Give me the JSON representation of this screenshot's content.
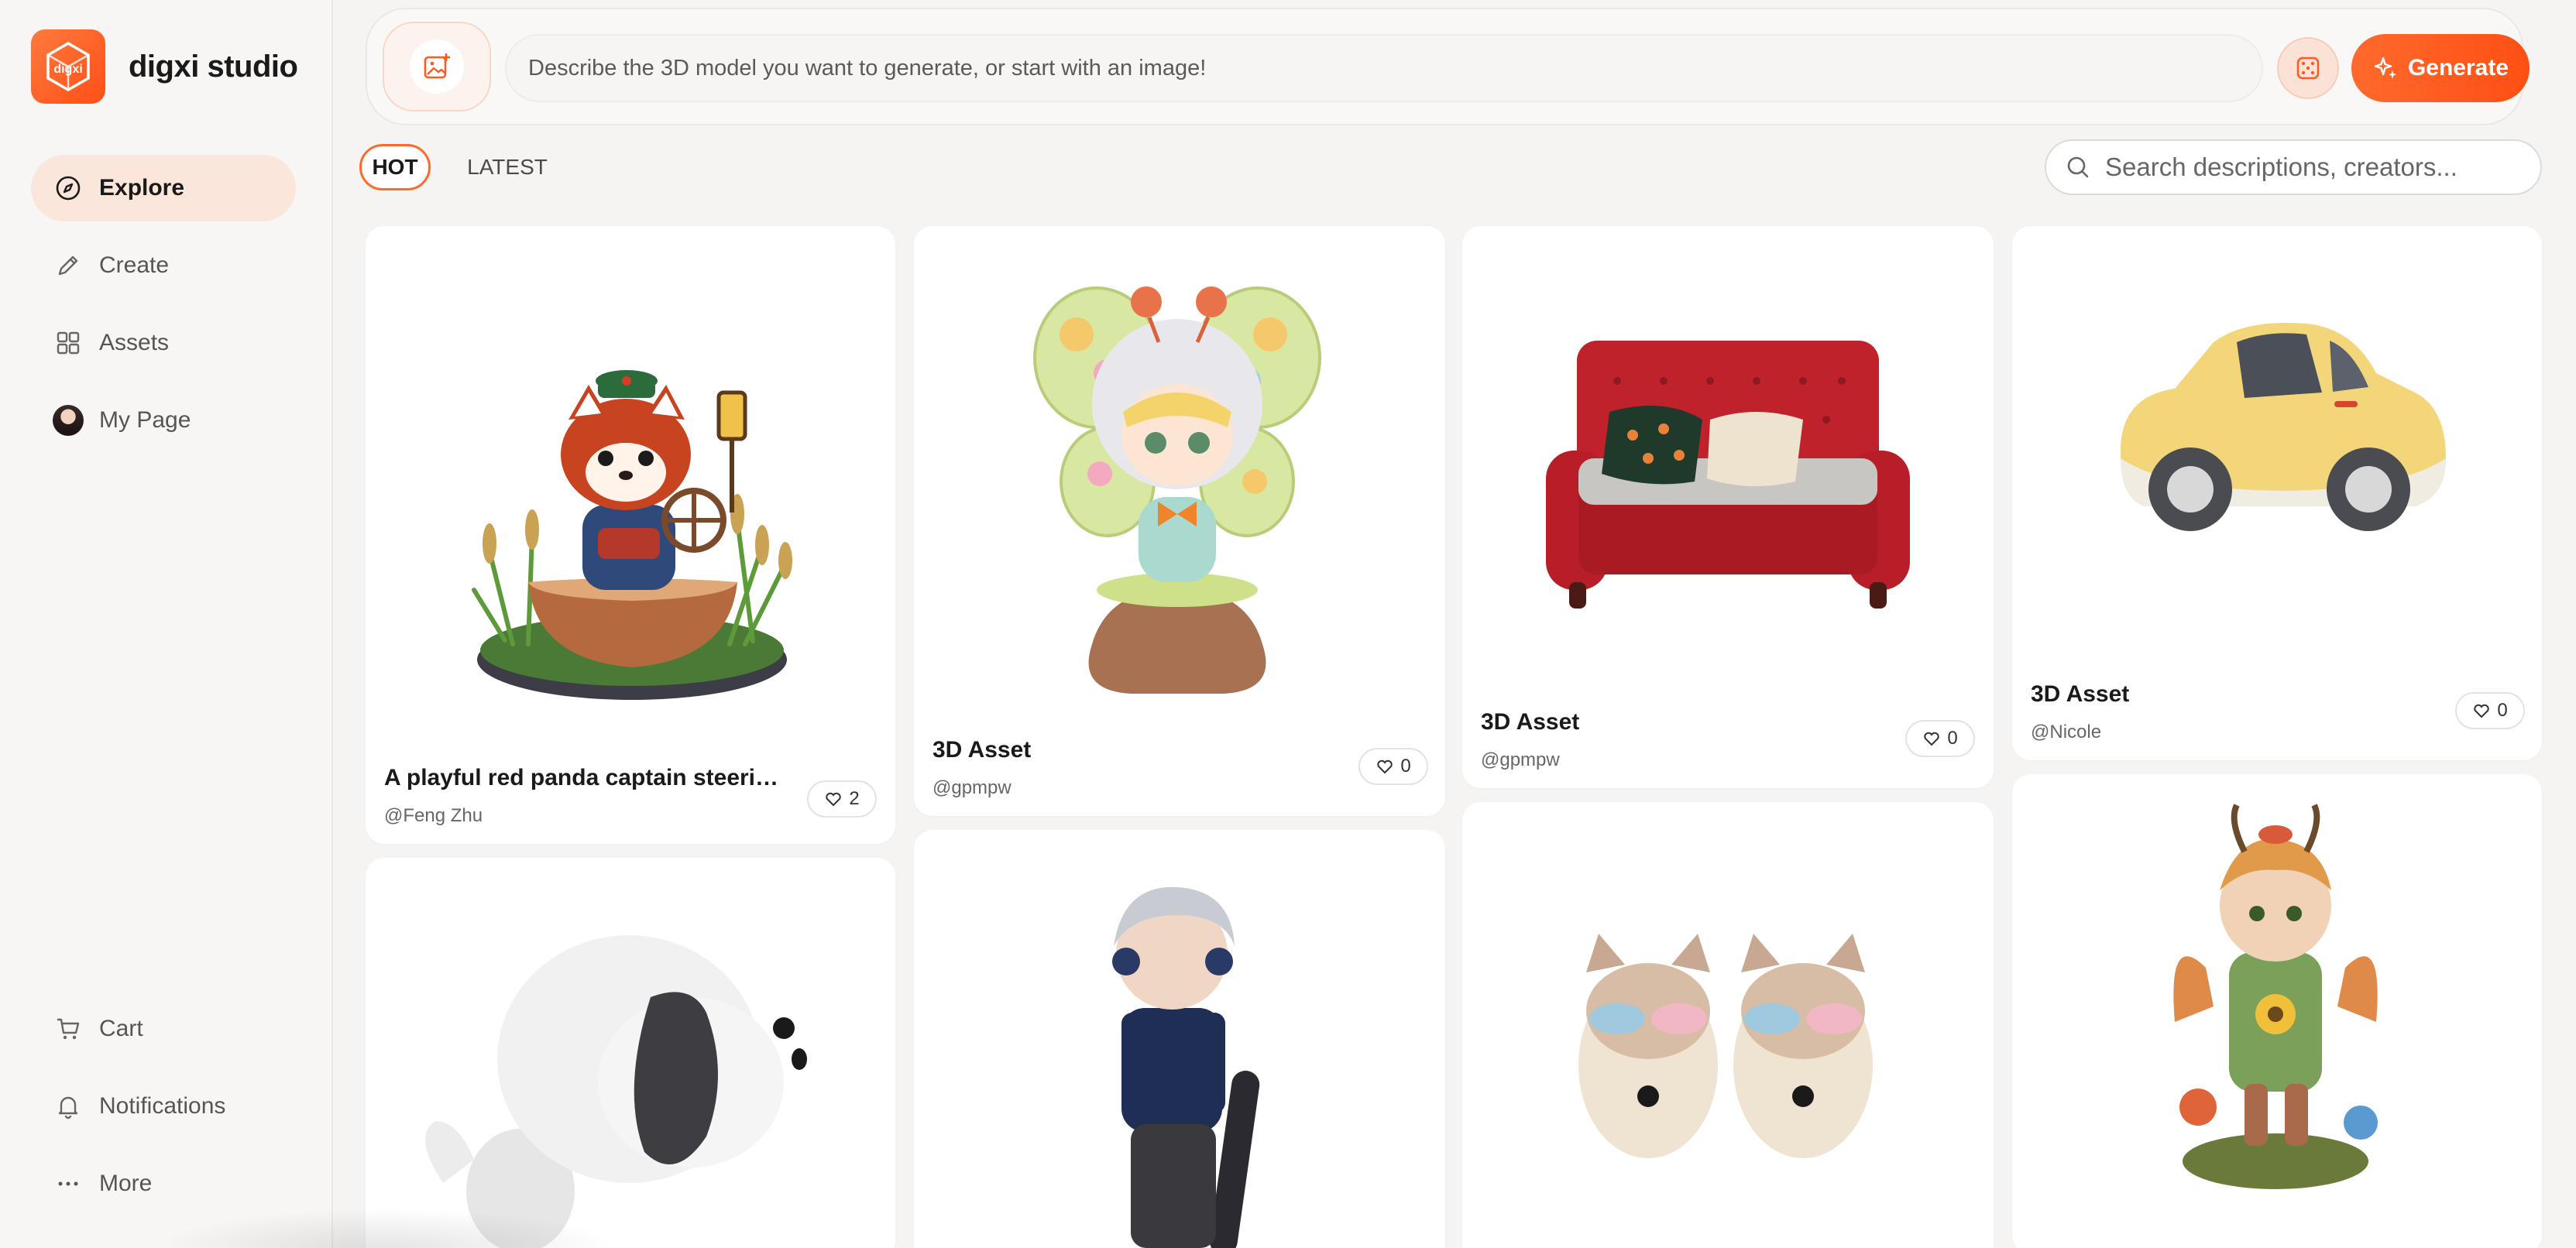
{
  "brand": {
    "name": "digxi studio",
    "logo_text": "digxi"
  },
  "sidebar": {
    "nav": [
      {
        "label": "Explore",
        "icon": "compass-icon",
        "active": true
      },
      {
        "label": "Create",
        "icon": "pencil-icon",
        "active": false
      },
      {
        "label": "Assets",
        "icon": "grid-icon",
        "active": false
      },
      {
        "label": "My Page",
        "icon": "avatar",
        "active": false
      }
    ],
    "bottom": [
      {
        "label": "Cart",
        "icon": "cart-icon"
      },
      {
        "label": "Notifications",
        "icon": "bell-icon"
      },
      {
        "label": "More",
        "icon": "more-dots-icon"
      }
    ]
  },
  "prompt": {
    "placeholder": "Describe the 3D model you want to generate, or start with an image!",
    "generate_label": "Generate"
  },
  "tabs": {
    "hot": "HOT",
    "latest": "LATEST"
  },
  "search": {
    "placeholder": "Search descriptions, creators..."
  },
  "cards": [
    {
      "title": "A playful red panda captain steering a...",
      "creator": "@Feng Zhu",
      "likes": "2",
      "subject": "red-panda-boat"
    },
    {
      "title": "3D Asset",
      "creator": "@gpmpw",
      "likes": "0",
      "subject": "butterfly-doll"
    },
    {
      "title": "3D Asset",
      "creator": "@gpmpw",
      "likes": "0",
      "subject": "red-sofa"
    },
    {
      "title": "3D Asset",
      "creator": "@Nicole",
      "likes": "0",
      "subject": "yellow-car"
    },
    {
      "subject": "white-puppy"
    },
    {
      "subject": "skater-boy"
    },
    {
      "subject": "cat-figures"
    },
    {
      "subject": "forest-fairy"
    }
  ],
  "colors": {
    "accent": "#ff5a1f",
    "active_nav_bg": "#fbe6dc",
    "page_bg": "#f6f4f2"
  }
}
